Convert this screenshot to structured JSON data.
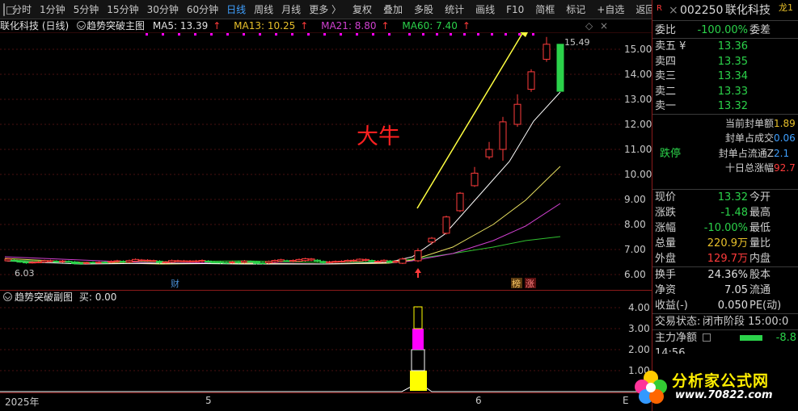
{
  "toolbar": {
    "items": [
      "分时",
      "1分钟",
      "5分钟",
      "15分钟",
      "30分钟",
      "60分钟",
      "日线",
      "周线",
      "月线",
      "更多 〉"
    ],
    "active_index": 6,
    "right": [
      "复权",
      "叠加",
      "多股",
      "统计",
      "画线",
      "F10",
      "简框",
      "标记",
      "+自选",
      "返回"
    ]
  },
  "infobar": {
    "stock_period": "联化科技 (日线)",
    "indicator": "趋势突破主图",
    "ma5": "MA5: 13.39",
    "ma13": "MA13: 10.25",
    "ma21": "MA21: 8.80",
    "ma60": "MA60: 7.40",
    "arrow": "↑"
  },
  "main": {
    "annotation": "大牛",
    "high_label": "15.49",
    "low_label": "6.03",
    "marker_cai": "财",
    "marker_bang": "榜",
    "marker_zhang": "涨",
    "y_ticks": [
      "15.00",
      "14.00",
      "13.00",
      "12.00",
      "11.00",
      "10.00",
      "9.00",
      "8.00",
      "7.00",
      "6.00"
    ],
    "colors": {
      "ma5": "#ffffff",
      "ma13": "#e8e060",
      "ma21": "#d040d0",
      "ma60": "#30c030",
      "up": "#ff3b3b",
      "down": "#2bd24a",
      "annotation": "#ff2020",
      "arrow": "#ffff40"
    }
  },
  "sub": {
    "title": "趋势突破副图",
    "buy_label": "买: 0.00",
    "y_ticks": [
      "4.00",
      "3.00",
      "2.00",
      "1.00"
    ]
  },
  "time_axis": {
    "labels": [
      "2025年",
      "5",
      "6"
    ],
    "right_edge": "E"
  },
  "panel": {
    "code": "002250",
    "name": "联化科技",
    "tag": "R",
    "dragon": "龙1",
    "weibi_label": "委比",
    "weibi_value": "-100.00%",
    "weicha_label": "委差",
    "asks": [
      {
        "label": "卖五 ¥",
        "price": "13.36"
      },
      {
        "label": "卖四",
        "price": "13.35"
      },
      {
        "label": "卖三",
        "price": "13.34"
      },
      {
        "label": "卖二",
        "price": "13.33"
      },
      {
        "label": "卖一",
        "price": "13.32"
      }
    ],
    "limit_status": "跌停",
    "seal_rows": [
      {
        "label": "当前封单额",
        "value": "1.89"
      },
      {
        "label": "封单占成交",
        "value": "0.06"
      },
      {
        "label": "封单占流通Z",
        "value": "2.1"
      },
      {
        "label": "十日总涨幅",
        "value": "92.7"
      }
    ],
    "quote": [
      {
        "l": "现价",
        "v": "13.32",
        "l2": "今开",
        "c": "green"
      },
      {
        "l": "涨跌",
        "v": "-1.48",
        "l2": "最高",
        "c": "green"
      },
      {
        "l": "涨幅",
        "v": "-10.00%",
        "l2": "最低",
        "c": "green"
      },
      {
        "l": "总量",
        "v": "220.9万",
        "l2": "量比",
        "c": "yellow"
      },
      {
        "l": "外盘",
        "v": "129.7万",
        "l2": "内盘",
        "c": "red"
      }
    ],
    "stats": [
      {
        "l": "换手",
        "v": "24.36%",
        "l2": "股本"
      },
      {
        "l": "净资",
        "v": "7.05",
        "l2": "流通"
      },
      {
        "l": "收益(-)",
        "v": "0.050",
        "l2": "PE(动)"
      }
    ],
    "trade_status_label": "交易状态:",
    "trade_status": "闭市阶段 15:00:0",
    "net_flow_label": "主力净额",
    "net_flow_value": "-8.8",
    "partial_time": "14:56",
    "watermark_name": "分析家公式网",
    "watermark_url": "www.70822.com"
  }
}
